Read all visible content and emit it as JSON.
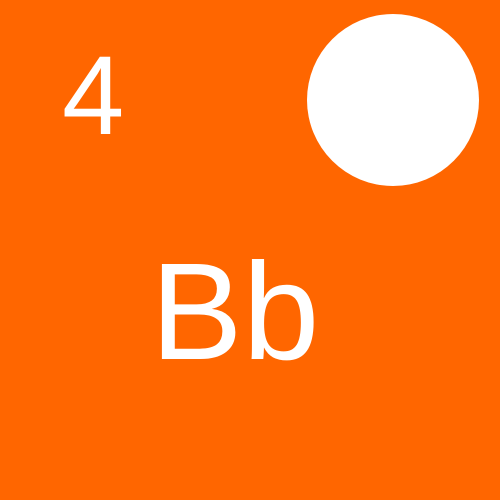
{
  "card": {
    "number": "4",
    "symbol": "Bb",
    "indicator": "filled-circle"
  },
  "colors": {
    "background": "#ff6600",
    "foreground": "#ffffff"
  }
}
